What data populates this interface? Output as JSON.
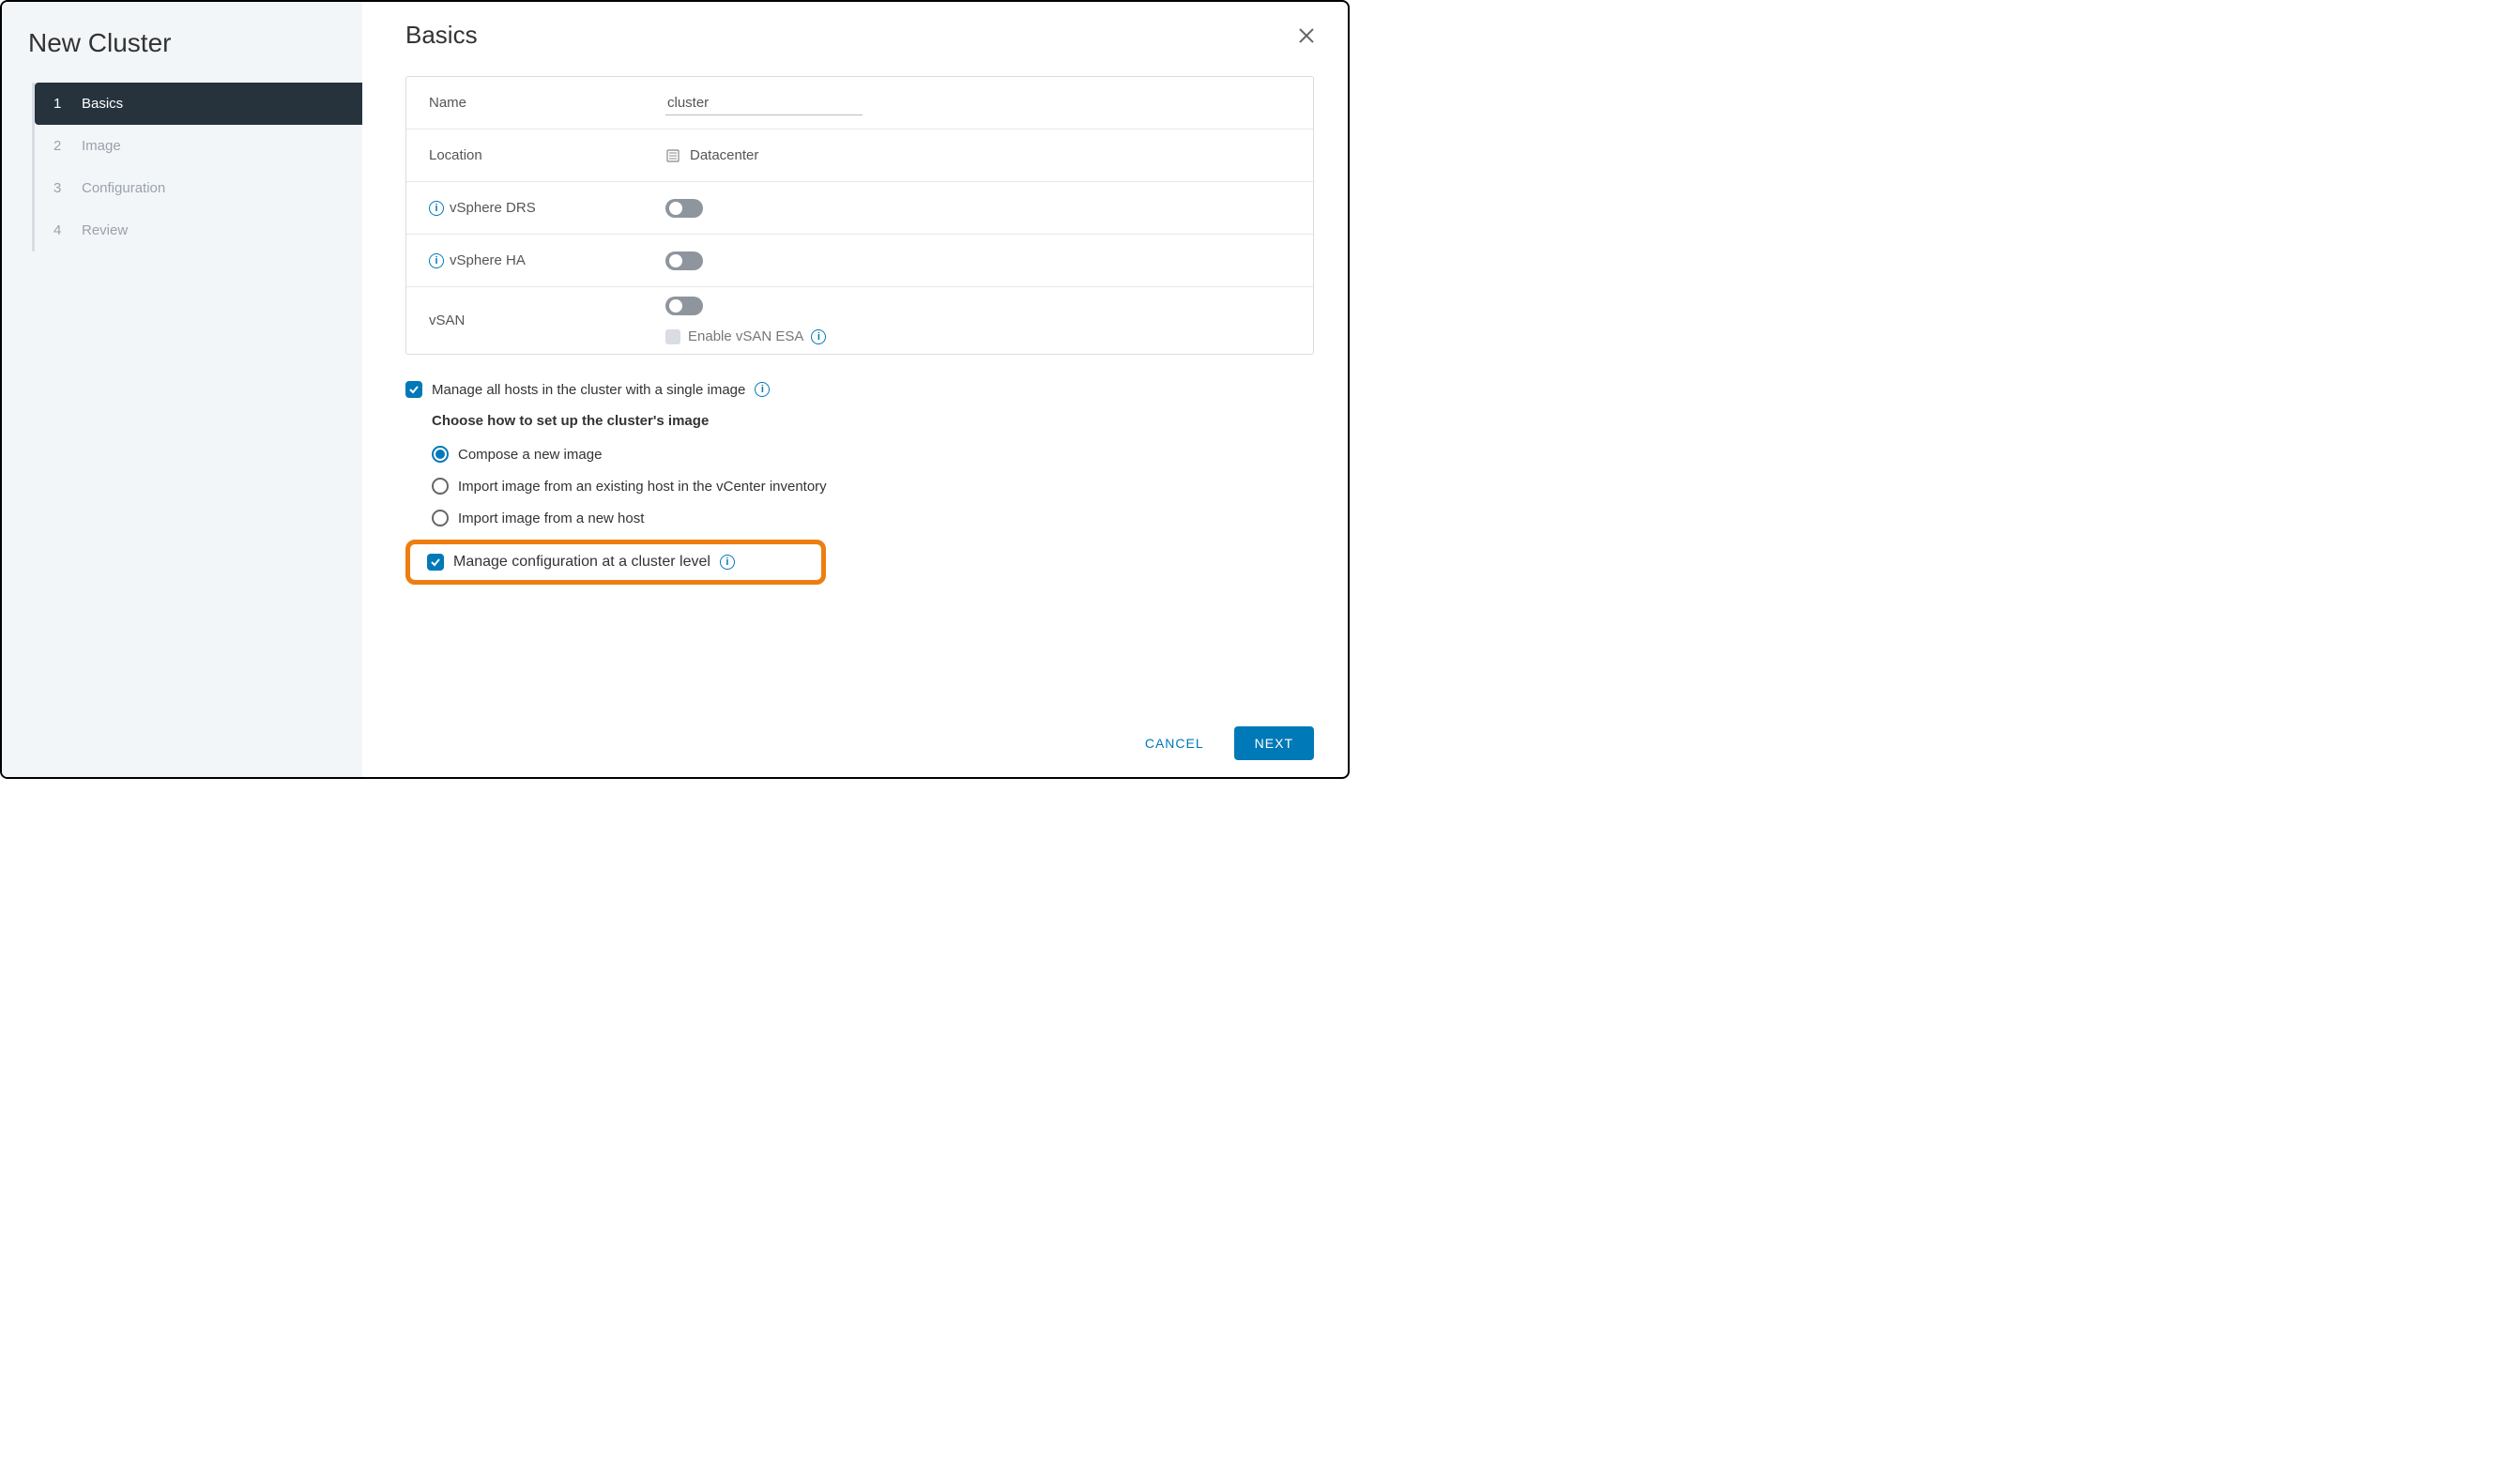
{
  "sidebar": {
    "title": "New Cluster",
    "steps": [
      {
        "num": "1",
        "label": "Basics",
        "active": true
      },
      {
        "num": "2",
        "label": "Image"
      },
      {
        "num": "3",
        "label": "Configuration"
      },
      {
        "num": "4",
        "label": "Review"
      }
    ]
  },
  "main": {
    "title": "Basics",
    "name_label": "Name",
    "name_value": "cluster",
    "location_label": "Location",
    "location_value": "Datacenter",
    "drs_label": "vSphere DRS",
    "ha_label": "vSphere HA",
    "vsan_label": "vSAN",
    "vsan_esa_label": "Enable vSAN ESA",
    "single_image_label": "Manage all hosts in the cluster with a single image",
    "choose_label": "Choose how to set up the cluster's image",
    "radio_options": [
      "Compose a new image",
      "Import image from an existing host in the vCenter inventory",
      "Import image from a new host"
    ],
    "selected_radio_index": 0,
    "config_level_label": "Manage configuration at a cluster level"
  },
  "footer": {
    "cancel": "CANCEL",
    "next": "NEXT"
  }
}
